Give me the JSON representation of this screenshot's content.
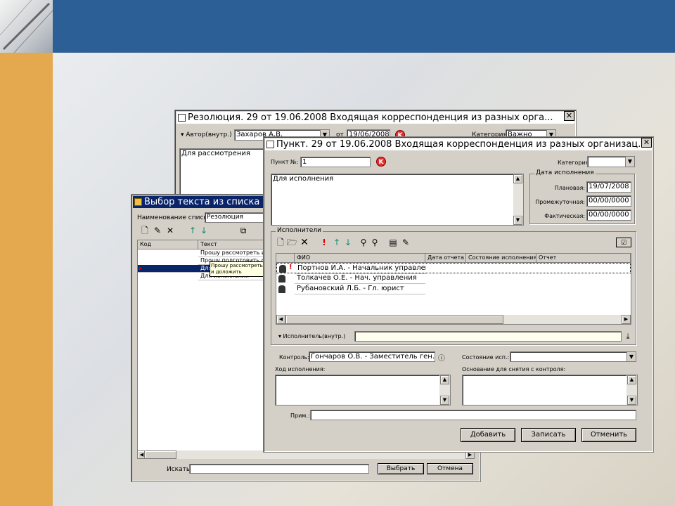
{
  "resolution_win": {
    "title": "Резолюция. 29 от 19.06.2008 Входящая корреспонденция из разных орга...",
    "author_label": "▾ Автор(внутр.)",
    "author_value": "Захаров А.В.",
    "from_label": "от",
    "date": "19/06/2008",
    "category_label": "Категория",
    "category_value": "Важно",
    "text": "Для рассмотрения"
  },
  "select_win": {
    "title": "Выбор текста из списка",
    "list_name_label": "Наименование списка:",
    "list_name_value": "Резолюция",
    "col_code": "Код",
    "col_text": "Текст",
    "rows": [
      "Прошу рассмотреть и д",
      "Прошу подготовить ответ",
      "Для",
      "Для исполнения"
    ],
    "tooltip": "Прошу рассмотреть и доложить",
    "search_label": "Искать:",
    "select_btn": "Выбрать",
    "cancel_btn": "Отмена"
  },
  "punkt_win": {
    "title": "Пункт. 29 от 19.06.2008 Входящая корреспонденция из разных организац...",
    "num_label": "Пункт №:",
    "num_value": "1",
    "category_label": "Категория:",
    "text": "Для исполнения",
    "dates_group": "Дата исполнения",
    "planned_label": "Плановая:",
    "planned_value": "19/07/2008",
    "interim_label": "Промежуточная:",
    "interim_value": "00/00/0000",
    "actual_label": "Фактическая:",
    "actual_value": "00/00/0000",
    "exec_group": "Исполнители",
    "cols": [
      "ФИО",
      "Дата отчета",
      "Состояние исполнения",
      "Отчет"
    ],
    "executors": [
      {
        "fio": "Портнов И.А. - Начальник управления",
        "mark": "!"
      },
      {
        "fio": "Толкачев О.Е. - Нач. управления",
        "mark": ""
      },
      {
        "fio": "Рубановский Л.Б. - Гл. юрист",
        "mark": ""
      }
    ],
    "executor_label": "▾ Исполнитель(внутр.)",
    "control_label": "Контроль:",
    "control_value": "Гончаров О.В. - Заместитель ген. ди",
    "state_label": "Состояние исп.:",
    "progress_label": "Ход исполнения:",
    "basis_label": "Основание для снятия с контроля:",
    "note_label": "Прим.:",
    "add_btn": "Добавить",
    "save_btn": "Записать",
    "cancel_btn": "Отменить"
  },
  "colors": {
    "header": "#2c5f95",
    "sidebar": "#e4a94f",
    "selection": "#0a246a"
  }
}
